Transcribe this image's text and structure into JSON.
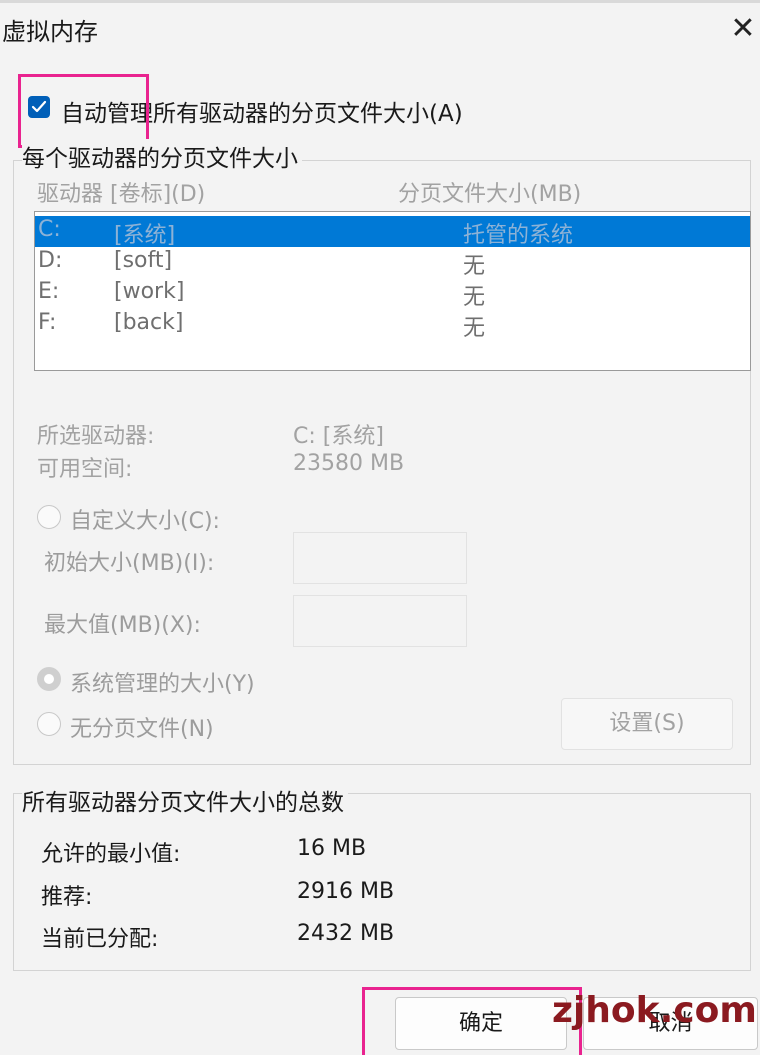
{
  "window": {
    "title": "虚拟内存",
    "close_glyph": "✕"
  },
  "auto_manage": {
    "label": "自动管理所有驱动器的分页文件大小(A)",
    "checked": true
  },
  "per_drive": {
    "group_title": "每个驱动器的分页文件大小",
    "col_drive": "驱动器 [卷标](D)",
    "col_size": "分页文件大小(MB)",
    "drives": [
      {
        "letter": "C:",
        "label": "[系统]",
        "size": "托管的系统",
        "selected": true
      },
      {
        "letter": "D:",
        "label": "[soft]",
        "size": "无",
        "selected": false
      },
      {
        "letter": "E:",
        "label": "[work]",
        "size": "无",
        "selected": false
      },
      {
        "letter": "F:",
        "label": "[back]",
        "size": "无",
        "selected": false
      }
    ],
    "selected_drive_label": "所选驱动器:",
    "selected_drive_value": "C:  [系统]",
    "free_space_label": "可用空间:",
    "free_space_value": "23580 MB",
    "custom_size": {
      "label": "自定义大小(C):",
      "selected": false
    },
    "initial_size": {
      "label": "初始大小(MB)(I):",
      "value": ""
    },
    "max_size": {
      "label": "最大值(MB)(X):",
      "value": ""
    },
    "system_managed": {
      "label": "系统管理的大小(Y)",
      "selected": true
    },
    "no_paging": {
      "label": "无分页文件(N)",
      "selected": false
    },
    "set_button": "设置(S)"
  },
  "totals": {
    "group_title": "所有驱动器分页文件大小的总数",
    "min_label": "允许的最小值:",
    "min_value": "16 MB",
    "recommended_label": "推荐:",
    "recommended_value": "2916 MB",
    "allocated_label": "当前已分配:",
    "allocated_value": "2432 MB"
  },
  "buttons": {
    "ok": "确定",
    "cancel": "取消"
  },
  "watermark": "zjhok.com",
  "colors": {
    "accent": "#005fb8",
    "selection": "#0079d6",
    "highlight": "#e9238f"
  }
}
